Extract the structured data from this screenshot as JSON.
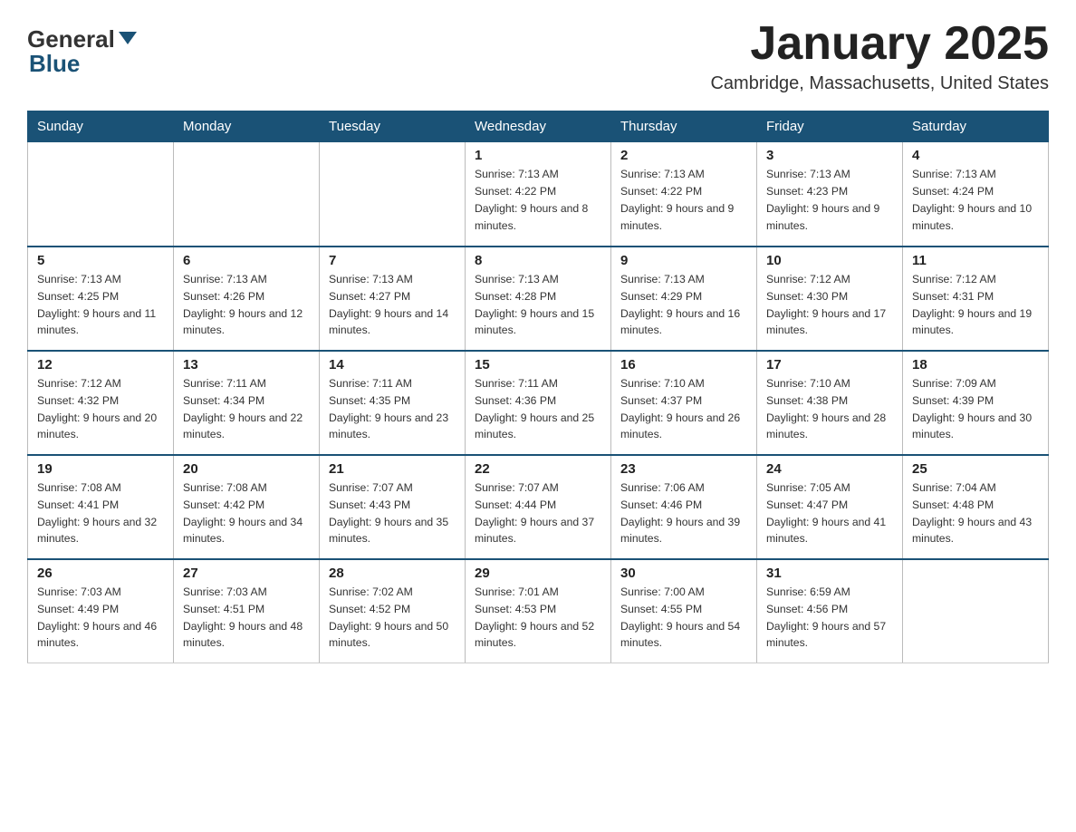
{
  "header": {
    "logo": {
      "general": "General",
      "blue": "Blue"
    },
    "title": "January 2025",
    "location": "Cambridge, Massachusetts, United States"
  },
  "days_of_week": [
    "Sunday",
    "Monday",
    "Tuesday",
    "Wednesday",
    "Thursday",
    "Friday",
    "Saturday"
  ],
  "weeks": [
    [
      {
        "day": "",
        "info": ""
      },
      {
        "day": "",
        "info": ""
      },
      {
        "day": "",
        "info": ""
      },
      {
        "day": "1",
        "info": "Sunrise: 7:13 AM\nSunset: 4:22 PM\nDaylight: 9 hours and 8 minutes."
      },
      {
        "day": "2",
        "info": "Sunrise: 7:13 AM\nSunset: 4:22 PM\nDaylight: 9 hours and 9 minutes."
      },
      {
        "day": "3",
        "info": "Sunrise: 7:13 AM\nSunset: 4:23 PM\nDaylight: 9 hours and 9 minutes."
      },
      {
        "day": "4",
        "info": "Sunrise: 7:13 AM\nSunset: 4:24 PM\nDaylight: 9 hours and 10 minutes."
      }
    ],
    [
      {
        "day": "5",
        "info": "Sunrise: 7:13 AM\nSunset: 4:25 PM\nDaylight: 9 hours and 11 minutes."
      },
      {
        "day": "6",
        "info": "Sunrise: 7:13 AM\nSunset: 4:26 PM\nDaylight: 9 hours and 12 minutes."
      },
      {
        "day": "7",
        "info": "Sunrise: 7:13 AM\nSunset: 4:27 PM\nDaylight: 9 hours and 14 minutes."
      },
      {
        "day": "8",
        "info": "Sunrise: 7:13 AM\nSunset: 4:28 PM\nDaylight: 9 hours and 15 minutes."
      },
      {
        "day": "9",
        "info": "Sunrise: 7:13 AM\nSunset: 4:29 PM\nDaylight: 9 hours and 16 minutes."
      },
      {
        "day": "10",
        "info": "Sunrise: 7:12 AM\nSunset: 4:30 PM\nDaylight: 9 hours and 17 minutes."
      },
      {
        "day": "11",
        "info": "Sunrise: 7:12 AM\nSunset: 4:31 PM\nDaylight: 9 hours and 19 minutes."
      }
    ],
    [
      {
        "day": "12",
        "info": "Sunrise: 7:12 AM\nSunset: 4:32 PM\nDaylight: 9 hours and 20 minutes."
      },
      {
        "day": "13",
        "info": "Sunrise: 7:11 AM\nSunset: 4:34 PM\nDaylight: 9 hours and 22 minutes."
      },
      {
        "day": "14",
        "info": "Sunrise: 7:11 AM\nSunset: 4:35 PM\nDaylight: 9 hours and 23 minutes."
      },
      {
        "day": "15",
        "info": "Sunrise: 7:11 AM\nSunset: 4:36 PM\nDaylight: 9 hours and 25 minutes."
      },
      {
        "day": "16",
        "info": "Sunrise: 7:10 AM\nSunset: 4:37 PM\nDaylight: 9 hours and 26 minutes."
      },
      {
        "day": "17",
        "info": "Sunrise: 7:10 AM\nSunset: 4:38 PM\nDaylight: 9 hours and 28 minutes."
      },
      {
        "day": "18",
        "info": "Sunrise: 7:09 AM\nSunset: 4:39 PM\nDaylight: 9 hours and 30 minutes."
      }
    ],
    [
      {
        "day": "19",
        "info": "Sunrise: 7:08 AM\nSunset: 4:41 PM\nDaylight: 9 hours and 32 minutes."
      },
      {
        "day": "20",
        "info": "Sunrise: 7:08 AM\nSunset: 4:42 PM\nDaylight: 9 hours and 34 minutes."
      },
      {
        "day": "21",
        "info": "Sunrise: 7:07 AM\nSunset: 4:43 PM\nDaylight: 9 hours and 35 minutes."
      },
      {
        "day": "22",
        "info": "Sunrise: 7:07 AM\nSunset: 4:44 PM\nDaylight: 9 hours and 37 minutes."
      },
      {
        "day": "23",
        "info": "Sunrise: 7:06 AM\nSunset: 4:46 PM\nDaylight: 9 hours and 39 minutes."
      },
      {
        "day": "24",
        "info": "Sunrise: 7:05 AM\nSunset: 4:47 PM\nDaylight: 9 hours and 41 minutes."
      },
      {
        "day": "25",
        "info": "Sunrise: 7:04 AM\nSunset: 4:48 PM\nDaylight: 9 hours and 43 minutes."
      }
    ],
    [
      {
        "day": "26",
        "info": "Sunrise: 7:03 AM\nSunset: 4:49 PM\nDaylight: 9 hours and 46 minutes."
      },
      {
        "day": "27",
        "info": "Sunrise: 7:03 AM\nSunset: 4:51 PM\nDaylight: 9 hours and 48 minutes."
      },
      {
        "day": "28",
        "info": "Sunrise: 7:02 AM\nSunset: 4:52 PM\nDaylight: 9 hours and 50 minutes."
      },
      {
        "day": "29",
        "info": "Sunrise: 7:01 AM\nSunset: 4:53 PM\nDaylight: 9 hours and 52 minutes."
      },
      {
        "day": "30",
        "info": "Sunrise: 7:00 AM\nSunset: 4:55 PM\nDaylight: 9 hours and 54 minutes."
      },
      {
        "day": "31",
        "info": "Sunrise: 6:59 AM\nSunset: 4:56 PM\nDaylight: 9 hours and 57 minutes."
      },
      {
        "day": "",
        "info": ""
      }
    ]
  ]
}
